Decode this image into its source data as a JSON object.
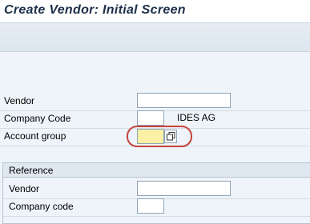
{
  "window": {
    "title": "Create Vendor:  Initial Screen"
  },
  "form": {
    "vendor_label": "Vendor",
    "vendor_value": "",
    "company_code_label": "Company Code",
    "company_code_value": "",
    "company_name": "IDES AG",
    "account_group_label": "Account group",
    "account_group_value": ""
  },
  "reference": {
    "title": "Reference",
    "vendor_label": "Vendor",
    "vendor_value": "",
    "company_code_label": "Company code",
    "company_code_value": ""
  },
  "colors": {
    "required_field": "#fbf0a5",
    "highlight": "#c8423a"
  }
}
